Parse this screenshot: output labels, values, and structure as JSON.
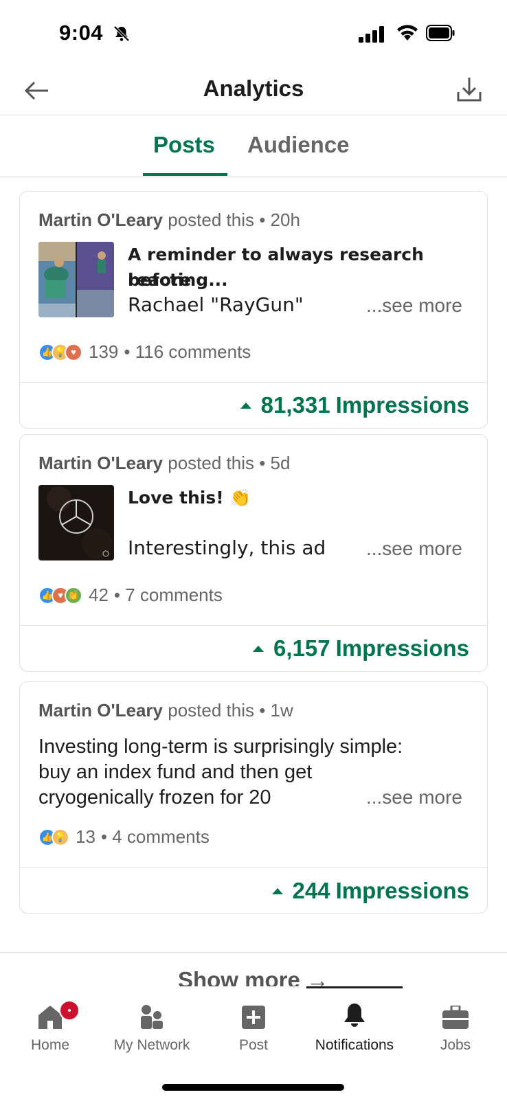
{
  "status_bar": {
    "time": "9:04"
  },
  "header": {
    "title": "Analytics"
  },
  "tabs": [
    {
      "label": "Posts",
      "active": true
    },
    {
      "label": "Audience",
      "active": false
    }
  ],
  "posts": [
    {
      "author": "Martin O'Leary",
      "posted_suffix": "posted this • 20h",
      "text_line1": "A reminder to always research before",
      "text_line2": "reacting...",
      "text_line3": "Rachael \"RayGun\"",
      "see_more": "...see more",
      "reaction_count": "139",
      "comments": "• 116 comments",
      "impressions_value": "81,331",
      "impressions_label": "Impressions"
    },
    {
      "author": "Martin O'Leary",
      "posted_suffix": "posted this • 5d",
      "text_line1": "Love this! 👏",
      "text_line3": "Interestingly, this ad",
      "see_more": "...see more",
      "reaction_count": "42",
      "comments": "• 7 comments",
      "impressions_value": "6,157",
      "impressions_label": "Impressions"
    },
    {
      "author": "Martin O'Leary",
      "posted_suffix": "posted this • 1w",
      "text_line1": "Investing long-term is surprisingly simple:",
      "text_line2": "buy an index fund and then get",
      "text_line3": "cryogenically frozen for 20",
      "see_more": "...see more",
      "reaction_count": "13",
      "comments": "• 4 comments",
      "impressions_value": "244",
      "impressions_label": "Impressions"
    }
  ],
  "show_more": "Show more →",
  "bottom_nav": [
    {
      "label": "Home",
      "icon": "home-icon"
    },
    {
      "label": "My Network",
      "icon": "network-icon"
    },
    {
      "label": "Post",
      "icon": "post-icon"
    },
    {
      "label": "Notifications",
      "icon": "bell-icon",
      "active": true
    },
    {
      "label": "Jobs",
      "icon": "briefcase-icon"
    }
  ],
  "colors": {
    "accent": "#01754f",
    "badge": "#cb112d"
  }
}
